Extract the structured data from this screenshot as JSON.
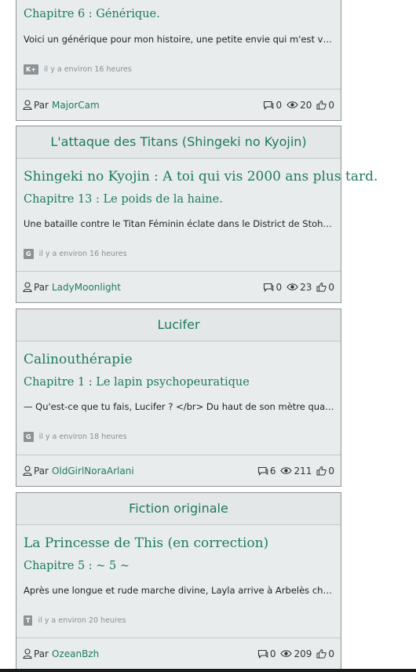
{
  "cards": [
    {
      "category": "",
      "story_title": "",
      "chapter_title": "Chapitre 6 : Générique.",
      "summary": "Voici un générique pour mon histoire, une petite envie qui m'est venu. It...",
      "rating": "K+",
      "time": "il y a environ 16 heures",
      "by_label": "Par",
      "author": "MajorCam",
      "comments": "0",
      "views": "20",
      "likes": "0"
    },
    {
      "category": "L'attaque des Titans (Shingeki no Kyojin)",
      "story_title": "Shingeki no Kyojin : A toi qui vis 2000 ans plus tard.",
      "chapter_title": "Chapitre 13 : Le poids de la haine.",
      "summary": "Une bataille contre le Titan Féminin éclate dans le District de Stohess, ...",
      "rating": "G",
      "time": "il y a environ 16 heures",
      "by_label": "Par",
      "author": "LadyMoonlight",
      "comments": "0",
      "views": "23",
      "likes": "0"
    },
    {
      "category": "Lucifer",
      "story_title": "Calinouthérapie",
      "chapter_title": "Chapitre 1 : Le lapin psychopeuratique",
      "summary": "— Qu'est-ce que tu fais, Lucifer ? </br> Du haut de son mètre quatre-vi...",
      "rating": "G",
      "time": "il y a environ 18 heures",
      "by_label": "Par",
      "author": "OldGirlNoraArlani",
      "comments": "6",
      "views": "211",
      "likes": "0"
    },
    {
      "category": "Fiction originale",
      "story_title": "La Princesse de This (en correction)",
      "chapter_title": "Chapitre 5 : ~ 5 ~",
      "summary": "Après une longue et rude marche divine, Layla arrive à Arbelès chez Ab...",
      "rating": "T",
      "time": "il y a environ 20 heures",
      "by_label": "Par",
      "author": "OzeanBzh",
      "comments": "0",
      "views": "209",
      "likes": "0"
    }
  ],
  "icons": {
    "user": "user-icon",
    "comments": "comment-icon",
    "views": "eye-icon",
    "likes": "thumbs-up-icon"
  },
  "colors": {
    "accent": "#1d7a5f",
    "card_bg": "#e9eced",
    "border": "#8f9192",
    "rating_badge": "#8b9396"
  }
}
